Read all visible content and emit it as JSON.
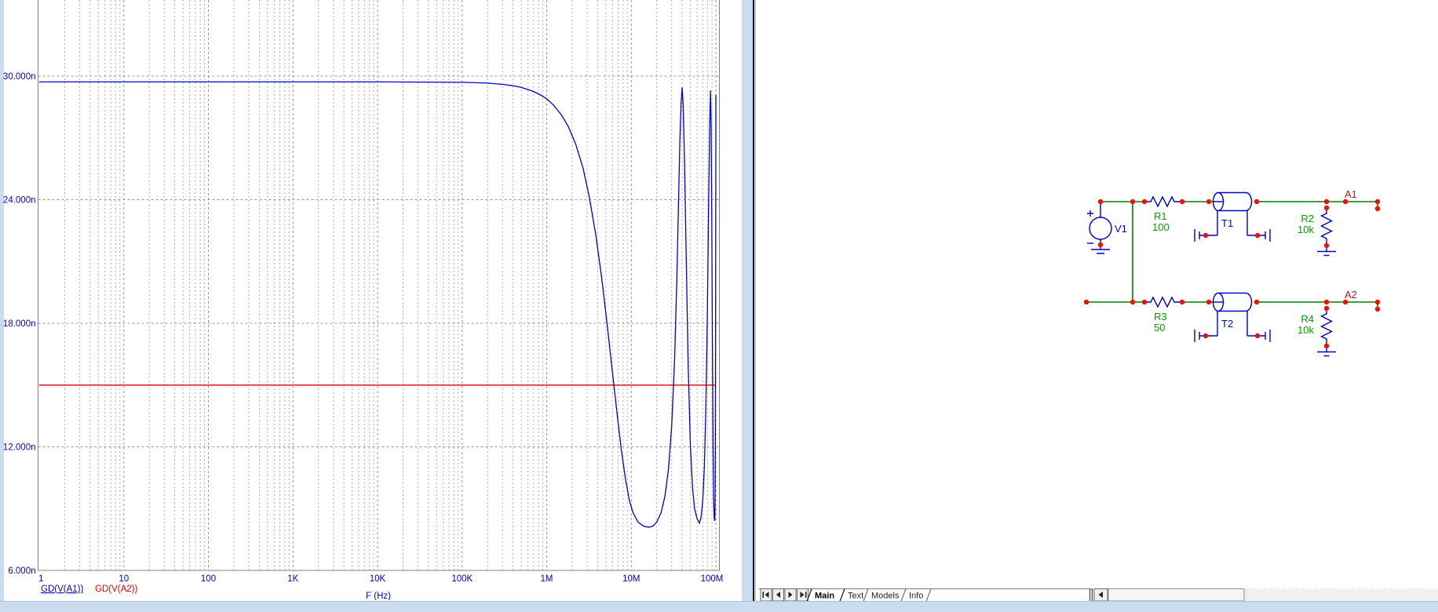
{
  "chart_data": {
    "type": "line",
    "title": "",
    "xlabel": "F (Hz)",
    "ylabel": "",
    "x_scale": "log",
    "x_range_hz": [
      1,
      100000000
    ],
    "grid": "log-dashed",
    "legend_position": "bottom-left",
    "y_ticks": [
      {
        "v": 30,
        "label": "30.000n"
      },
      {
        "v": 24,
        "label": "24.000n"
      },
      {
        "v": 18,
        "label": "18.000n"
      },
      {
        "v": 12,
        "label": "12.000n"
      },
      {
        "v": 6,
        "label": "6.000n"
      }
    ],
    "x_ticks": [
      {
        "f": 1,
        "label": "1"
      },
      {
        "f": 10,
        "label": "10"
      },
      {
        "f": 100,
        "label": "100"
      },
      {
        "f": 1000,
        "label": "1K"
      },
      {
        "f": 10000,
        "label": "10K"
      },
      {
        "f": 100000,
        "label": "100K"
      },
      {
        "f": 1000000,
        "label": "1M"
      },
      {
        "f": 10000000,
        "label": "10M"
      },
      {
        "f": 100000000,
        "label": "100M"
      }
    ],
    "series": [
      {
        "name": "GD(V(A1))",
        "color": "#0000cc",
        "underlined": true,
        "points_hz_ns": [
          [
            1,
            29.72
          ],
          [
            10,
            29.72
          ],
          [
            100,
            29.72
          ],
          [
            1000,
            29.72
          ],
          [
            10000,
            29.72
          ],
          [
            100000,
            29.7
          ],
          [
            200000,
            29.66
          ],
          [
            300000,
            29.6
          ],
          [
            400000,
            29.53
          ],
          [
            500000,
            29.45
          ],
          [
            650000,
            29.3
          ],
          [
            800000,
            29.14
          ],
          [
            1000000,
            28.9
          ],
          [
            1200000,
            28.6
          ],
          [
            1500000,
            28.1
          ],
          [
            1800000,
            27.55
          ],
          [
            2200000,
            26.7
          ],
          [
            2700000,
            25.5
          ],
          [
            3200000,
            24.1
          ],
          [
            3800000,
            22.3
          ],
          [
            4500000,
            20.1
          ],
          [
            5200000,
            17.9
          ],
          [
            6000000,
            15.6
          ],
          [
            6800000,
            13.6
          ],
          [
            7600000,
            11.9
          ],
          [
            8500000,
            10.5
          ],
          [
            9500000,
            9.4
          ],
          [
            10500000,
            8.8
          ],
          [
            12000000,
            8.35
          ],
          [
            14000000,
            8.15
          ],
          [
            16000000,
            8.1
          ],
          [
            18000000,
            8.15
          ],
          [
            20000000,
            8.35
          ],
          [
            22500000,
            8.8
          ],
          [
            25000000,
            9.6
          ],
          [
            27500000,
            10.9
          ],
          [
            30000000,
            13
          ],
          [
            32500000,
            16.2
          ],
          [
            34500000,
            20
          ],
          [
            36000000,
            23.5
          ],
          [
            37500000,
            26.8
          ],
          [
            38800000,
            28.7
          ],
          [
            40000000,
            29.45
          ],
          [
            41000000,
            28.6
          ],
          [
            42500000,
            26
          ],
          [
            44500000,
            21.5
          ],
          [
            47000000,
            16
          ],
          [
            50000000,
            12
          ],
          [
            53000000,
            10
          ],
          [
            56000000,
            9
          ],
          [
            60000000,
            8.5
          ],
          [
            64000000,
            8.3
          ],
          [
            67000000,
            8.6
          ],
          [
            70000000,
            9.4
          ],
          [
            73000000,
            11
          ],
          [
            76000000,
            13.8
          ],
          [
            79000000,
            18
          ],
          [
            82000000,
            23.5
          ],
          [
            84500000,
            27.5
          ],
          [
            86500000,
            29.3
          ],
          [
            88000000,
            27.5
          ],
          [
            89500000,
            23
          ],
          [
            91000000,
            17
          ],
          [
            92500000,
            12
          ],
          [
            94000000,
            9.5
          ],
          [
            95500000,
            8.6
          ],
          [
            97000000,
            8.4
          ],
          [
            98000000,
            9.5
          ],
          [
            98800000,
            13
          ],
          [
            99400000,
            19
          ],
          [
            99800000,
            25
          ],
          [
            100000000,
            29.1
          ]
        ]
      },
      {
        "name": "GD(V(A2))",
        "color": "#e00000",
        "underlined": false,
        "points_hz_ns": [
          [
            1,
            15
          ],
          [
            100000000,
            15
          ]
        ]
      }
    ]
  },
  "schematic": {
    "components": {
      "v1": {
        "ref": "V1",
        "type": "voltage-source"
      },
      "r1": {
        "ref": "R1",
        "value": "100",
        "type": "resistor"
      },
      "t1": {
        "ref": "T1",
        "type": "transmission-line"
      },
      "r2": {
        "ref": "R2",
        "value": "10k",
        "type": "resistor"
      },
      "r3": {
        "ref": "R3",
        "value": "50",
        "type": "resistor"
      },
      "t2": {
        "ref": "T2",
        "type": "transmission-line"
      },
      "r4": {
        "ref": "R4",
        "value": "10k",
        "type": "resistor"
      }
    },
    "nodes": {
      "a1": "A1",
      "a2": "A2"
    },
    "colors": {
      "wire": "#007d00",
      "component": "#0000cd",
      "value_label": "#00a000",
      "node_label": "#a52019",
      "junction_dot": "#ee1100"
    }
  },
  "tabbar": {
    "tabs": [
      {
        "label": "Main",
        "active": true
      },
      {
        "label": "Text",
        "active": false
      },
      {
        "label": "Models",
        "active": false
      },
      {
        "label": "Info",
        "active": false
      }
    ]
  }
}
